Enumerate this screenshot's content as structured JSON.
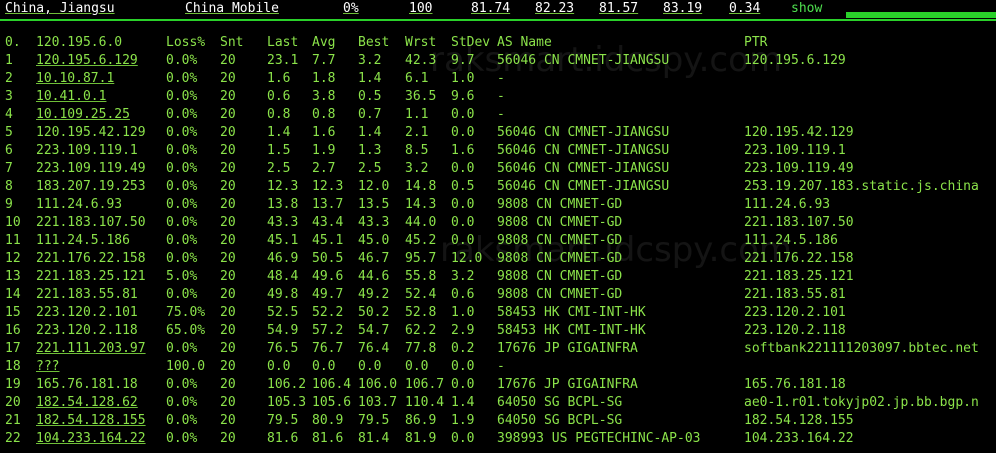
{
  "header": {
    "location": "China, Jiangsu",
    "isp": "China Mobile",
    "loss": "0%",
    "sent": "100",
    "v1": "81.74",
    "v2": "82.23",
    "v3": "81.57",
    "v4": "83.19",
    "v5": "0.34",
    "show_label": "show"
  },
  "columns": [
    "0.",
    "Loss%",
    "Snt",
    "Last",
    "Avg",
    "Best",
    "Wrst",
    "StDev",
    "AS Name",
    "PTR"
  ],
  "first_host": "120.195.6.0",
  "rows": [
    {
      "n": "1",
      "host": "120.195.6.129",
      "loss": "0.0%",
      "snt": "20",
      "last": "23.1",
      "avg": "7.7",
      "best": "3.2",
      "wrst": "42.3",
      "stdev": "9.7",
      "asn": "56046 CN CMNET-JIANGSU",
      "ptr": "120.195.6.129",
      "ul": true
    },
    {
      "n": "2",
      "host": "10.10.87.1",
      "loss": "0.0%",
      "snt": "20",
      "last": "1.6",
      "avg": "1.8",
      "best": "1.4",
      "wrst": "6.1",
      "stdev": "1.0",
      "asn": "-",
      "ptr": "",
      "ul": true
    },
    {
      "n": "3",
      "host": "10.41.0.1",
      "loss": "0.0%",
      "snt": "20",
      "last": "0.6",
      "avg": "3.8",
      "best": "0.5",
      "wrst": "36.5",
      "stdev": "9.6",
      "asn": "-",
      "ptr": "",
      "ul": true
    },
    {
      "n": "4",
      "host": "10.109.25.25",
      "loss": "0.0%",
      "snt": "20",
      "last": "0.8",
      "avg": "0.8",
      "best": "0.7",
      "wrst": "1.1",
      "stdev": "0.0",
      "asn": "-",
      "ptr": "",
      "ul": true
    },
    {
      "n": "5",
      "host": "120.195.42.129",
      "loss": "0.0%",
      "snt": "20",
      "last": "1.4",
      "avg": "1.6",
      "best": "1.4",
      "wrst": "2.1",
      "stdev": "0.0",
      "asn": "56046 CN CMNET-JIANGSU",
      "ptr": "120.195.42.129",
      "ul": false
    },
    {
      "n": "6",
      "host": "223.109.119.1",
      "loss": "0.0%",
      "snt": "20",
      "last": "1.5",
      "avg": "1.9",
      "best": "1.3",
      "wrst": "8.5",
      "stdev": "1.6",
      "asn": "56046 CN CMNET-JIANGSU",
      "ptr": "223.109.119.1",
      "ul": false
    },
    {
      "n": "7",
      "host": "223.109.119.49",
      "loss": "0.0%",
      "snt": "20",
      "last": "2.5",
      "avg": "2.7",
      "best": "2.5",
      "wrst": "3.2",
      "stdev": "0.0",
      "asn": "56046 CN CMNET-JIANGSU",
      "ptr": "223.109.119.49",
      "ul": false
    },
    {
      "n": "8",
      "host": "183.207.19.253",
      "loss": "0.0%",
      "snt": "20",
      "last": "12.3",
      "avg": "12.3",
      "best": "12.0",
      "wrst": "14.8",
      "stdev": "0.5",
      "asn": "56046 CN CMNET-JIANGSU",
      "ptr": "253.19.207.183.static.js.china",
      "ul": false
    },
    {
      "n": "9",
      "host": "111.24.6.93",
      "loss": "0.0%",
      "snt": "20",
      "last": "13.8",
      "avg": "13.7",
      "best": "13.5",
      "wrst": "14.3",
      "stdev": "0.0",
      "asn": "9808  CN CMNET-GD",
      "ptr": "111.24.6.93",
      "ul": false
    },
    {
      "n": "10",
      "host": "221.183.107.50",
      "loss": "0.0%",
      "snt": "20",
      "last": "43.3",
      "avg": "43.4",
      "best": "43.3",
      "wrst": "44.0",
      "stdev": "0.0",
      "asn": "9808  CN CMNET-GD",
      "ptr": "221.183.107.50",
      "ul": false
    },
    {
      "n": "11",
      "host": "111.24.5.186",
      "loss": "0.0%",
      "snt": "20",
      "last": "45.1",
      "avg": "45.1",
      "best": "45.0",
      "wrst": "45.2",
      "stdev": "0.0",
      "asn": "9808  CN CMNET-GD",
      "ptr": "111.24.5.186",
      "ul": false
    },
    {
      "n": "12",
      "host": "221.176.22.158",
      "loss": "0.0%",
      "snt": "20",
      "last": "46.9",
      "avg": "50.5",
      "best": "46.7",
      "wrst": "95.7",
      "stdev": "12.0",
      "asn": "9808  CN CMNET-GD",
      "ptr": "221.176.22.158",
      "ul": false
    },
    {
      "n": "13",
      "host": "221.183.25.121",
      "loss": "5.0%",
      "snt": "20",
      "last": "48.4",
      "avg": "49.6",
      "best": "44.6",
      "wrst": "55.8",
      "stdev": "3.2",
      "asn": "9808  CN CMNET-GD",
      "ptr": "221.183.25.121",
      "ul": false
    },
    {
      "n": "14",
      "host": "221.183.55.81",
      "loss": "0.0%",
      "snt": "20",
      "last": "49.8",
      "avg": "49.7",
      "best": "49.2",
      "wrst": "52.4",
      "stdev": "0.6",
      "asn": "9808  CN CMNET-GD",
      "ptr": "221.183.55.81",
      "ul": false
    },
    {
      "n": "15",
      "host": "223.120.2.101",
      "loss": "75.0%",
      "snt": "20",
      "last": "52.5",
      "avg": "52.2",
      "best": "50.2",
      "wrst": "52.8",
      "stdev": "1.0",
      "asn": "58453 HK CMI-INT-HK",
      "ptr": "223.120.2.101",
      "ul": false
    },
    {
      "n": "16",
      "host": "223.120.2.118",
      "loss": "65.0%",
      "snt": "20",
      "last": "54.9",
      "avg": "57.2",
      "best": "54.7",
      "wrst": "62.2",
      "stdev": "2.9",
      "asn": "58453 HK CMI-INT-HK",
      "ptr": "223.120.2.118",
      "ul": false
    },
    {
      "n": "17",
      "host": "221.111.203.97",
      "loss": "0.0%",
      "snt": "20",
      "last": "76.5",
      "avg": "76.7",
      "best": "76.4",
      "wrst": "77.8",
      "stdev": "0.2",
      "asn": "17676 JP GIGAINFRA",
      "ptr": "softbank221111203097.bbtec.net",
      "ul": true
    },
    {
      "n": "18",
      "host": "???",
      "loss": "100.0",
      "snt": "20",
      "last": "0.0",
      "avg": "0.0",
      "best": "0.0",
      "wrst": "0.0",
      "stdev": "0.0",
      "asn": "-",
      "ptr": "",
      "ul": true
    },
    {
      "n": "19",
      "host": "165.76.181.18",
      "loss": "0.0%",
      "snt": "20",
      "last": "106.2",
      "avg": "106.4",
      "best": "106.0",
      "wrst": "106.7",
      "stdev": "0.0",
      "asn": "17676 JP GIGAINFRA",
      "ptr": "165.76.181.18",
      "ul": false
    },
    {
      "n": "20",
      "host": "182.54.128.62",
      "loss": "0.0%",
      "snt": "20",
      "last": "105.3",
      "avg": "105.6",
      "best": "103.7",
      "wrst": "110.4",
      "stdev": "1.4",
      "asn": "64050 SG BCPL-SG",
      "ptr": "ae0-1.r01.tokyjp02.jp.bb.bgp.n",
      "ul": true
    },
    {
      "n": "21",
      "host": "182.54.128.155",
      "loss": "0.0%",
      "snt": "20",
      "last": "79.5",
      "avg": "80.9",
      "best": "79.5",
      "wrst": "86.9",
      "stdev": "1.9",
      "asn": "64050 SG BCPL-SG",
      "ptr": "182.54.128.155",
      "ul": true
    },
    {
      "n": "22",
      "host": "104.233.164.22",
      "loss": "0.0%",
      "snt": "20",
      "last": "81.6",
      "avg": "81.6",
      "best": "81.4",
      "wrst": "81.9",
      "stdev": "0.0",
      "asn": "398993 US PEGTECHINC-AP-03",
      "ptr": "104.233.164.22",
      "ul": true
    }
  ]
}
